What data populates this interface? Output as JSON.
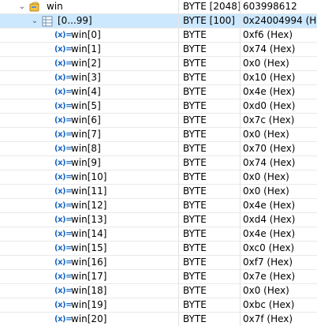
{
  "root": {
    "name": "win",
    "type": "BYTE [2048]",
    "value": "603998612",
    "icon": "pointer-struct-icon"
  },
  "range": {
    "name": "[0...99]",
    "type": "BYTE [100]",
    "value": "0x24004994 (Hex)",
    "icon": "array-range-icon"
  },
  "items": [
    {
      "name": "win[0]",
      "type": "BYTE",
      "value": "0xf6 (Hex)"
    },
    {
      "name": "win[1]",
      "type": "BYTE",
      "value": "0x74 (Hex)"
    },
    {
      "name": "win[2]",
      "type": "BYTE",
      "value": "0x0 (Hex)"
    },
    {
      "name": "win[3]",
      "type": "BYTE",
      "value": "0x10 (Hex)"
    },
    {
      "name": "win[4]",
      "type": "BYTE",
      "value": "0x4e (Hex)"
    },
    {
      "name": "win[5]",
      "type": "BYTE",
      "value": "0xd0 (Hex)"
    },
    {
      "name": "win[6]",
      "type": "BYTE",
      "value": "0x7c (Hex)"
    },
    {
      "name": "win[7]",
      "type": "BYTE",
      "value": "0x0 (Hex)"
    },
    {
      "name": "win[8]",
      "type": "BYTE",
      "value": "0x70 (Hex)"
    },
    {
      "name": "win[9]",
      "type": "BYTE",
      "value": "0x74 (Hex)"
    },
    {
      "name": "win[10]",
      "type": "BYTE",
      "value": "0x0 (Hex)"
    },
    {
      "name": "win[11]",
      "type": "BYTE",
      "value": "0x0 (Hex)"
    },
    {
      "name": "win[12]",
      "type": "BYTE",
      "value": "0x4e (Hex)"
    },
    {
      "name": "win[13]",
      "type": "BYTE",
      "value": "0xd4 (Hex)"
    },
    {
      "name": "win[14]",
      "type": "BYTE",
      "value": "0x4e (Hex)"
    },
    {
      "name": "win[15]",
      "type": "BYTE",
      "value": "0xc0 (Hex)"
    },
    {
      "name": "win[16]",
      "type": "BYTE",
      "value": "0xf7 (Hex)"
    },
    {
      "name": "win[17]",
      "type": "BYTE",
      "value": "0x7e (Hex)"
    },
    {
      "name": "win[18]",
      "type": "BYTE",
      "value": "0x0 (Hex)"
    },
    {
      "name": "win[19]",
      "type": "BYTE",
      "value": "0xbc (Hex)"
    },
    {
      "name": "win[20]",
      "type": "BYTE",
      "value": "0x7f (Hex)"
    }
  ],
  "variable_icon_text": "(x)=",
  "colors": {
    "selection": "#cce8ff",
    "variable_icon": "#1565c0"
  }
}
